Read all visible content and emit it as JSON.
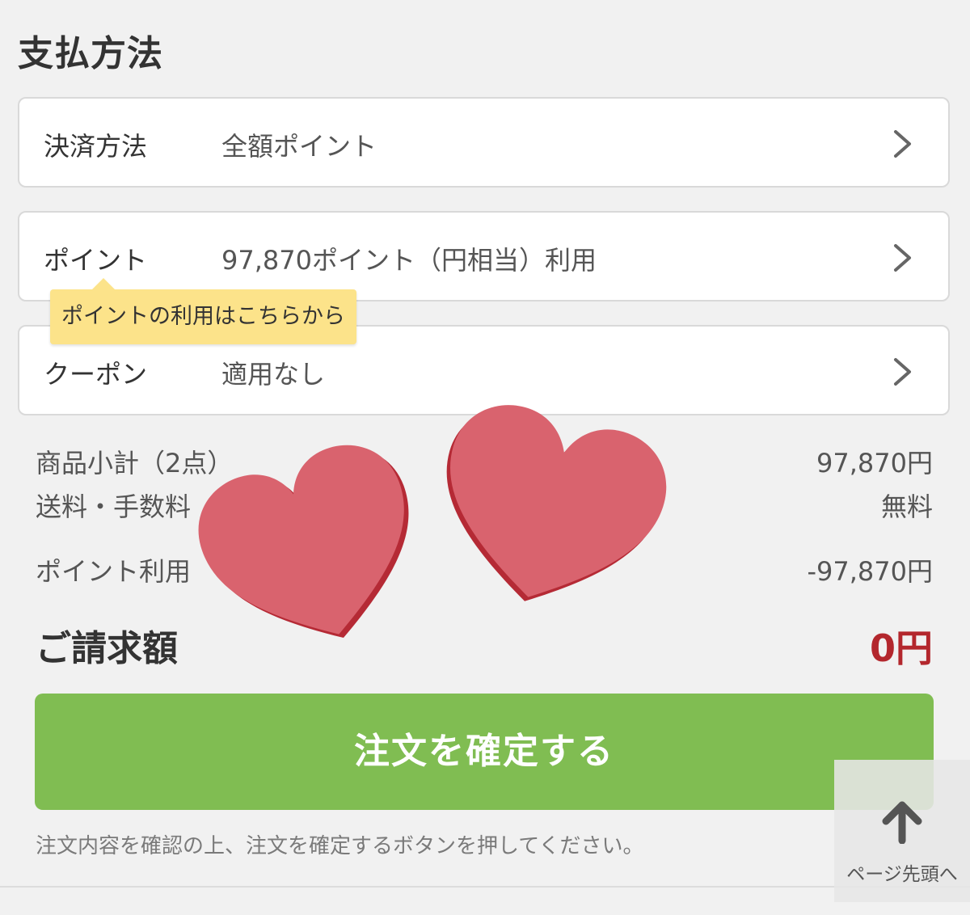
{
  "section": {
    "title": "支払方法"
  },
  "rows": [
    {
      "label": "決済方法",
      "value": "全額ポイント",
      "icon": "chevron-right-icon"
    },
    {
      "label": "ポイント",
      "value": "97,870ポイント（円相当）利用",
      "icon": "chevron-right-icon"
    },
    {
      "label": "クーポン",
      "value": "適用なし",
      "icon": "chevron-right-icon"
    }
  ],
  "tooltip": {
    "text": "ポイントの利用はこちらから"
  },
  "summary": {
    "subtotal_label": "商品小計（2点）",
    "subtotal_value": "97,870円",
    "shipping_label": "送料・手数料",
    "shipping_value": "無料",
    "points_label": "ポイント利用",
    "points_value": "-97,870円",
    "total_label": "ご請求額",
    "total_value": "0円"
  },
  "confirm": {
    "label": "注文を確定する",
    "color": "#80bd52"
  },
  "note": "注文内容を確認の上、注文を確定するボタンを押してください。",
  "page_top": {
    "label": "ページ先頭へ",
    "icon": "arrow-up-icon"
  },
  "colors": {
    "total": "#b3272d",
    "heart": "#d9636e",
    "tooltip": "#fce38a"
  }
}
